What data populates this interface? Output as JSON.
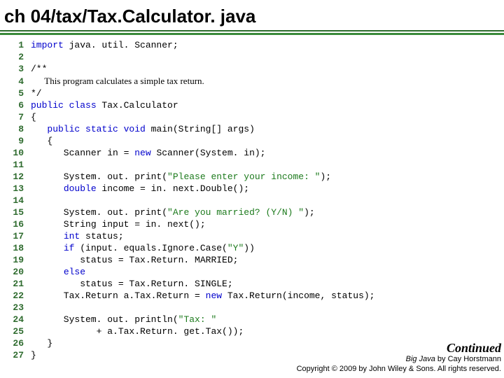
{
  "title": "ch 04/tax/Tax.Calculator. java",
  "code": {
    "lines": [
      {
        "n": "1",
        "seg": [
          {
            "t": "kw",
            "v": "import"
          },
          {
            "t": "p",
            "v": " java. util. Scanner;"
          }
        ]
      },
      {
        "n": "2",
        "seg": []
      },
      {
        "n": "3",
        "seg": [
          {
            "t": "p",
            "v": "/**"
          }
        ]
      },
      {
        "n": "4",
        "seg": [
          {
            "t": "com",
            "v": "      This program calculates a simple tax return."
          }
        ]
      },
      {
        "n": "5",
        "seg": [
          {
            "t": "p",
            "v": "*/"
          }
        ]
      },
      {
        "n": "6",
        "seg": [
          {
            "t": "kw",
            "v": "public class"
          },
          {
            "t": "p",
            "v": " Tax.Calculator"
          }
        ]
      },
      {
        "n": "7",
        "seg": [
          {
            "t": "p",
            "v": "{"
          }
        ]
      },
      {
        "n": "8",
        "seg": [
          {
            "t": "p",
            "v": "   "
          },
          {
            "t": "kw",
            "v": "public static void"
          },
          {
            "t": "p",
            "v": " main(String[] args)"
          }
        ]
      },
      {
        "n": "9",
        "seg": [
          {
            "t": "p",
            "v": "   {"
          }
        ]
      },
      {
        "n": "10",
        "seg": [
          {
            "t": "p",
            "v": "      Scanner in = "
          },
          {
            "t": "kw",
            "v": "new"
          },
          {
            "t": "p",
            "v": " Scanner(System. in);"
          }
        ]
      },
      {
        "n": "11",
        "seg": []
      },
      {
        "n": "12",
        "seg": [
          {
            "t": "p",
            "v": "      System. out. print("
          },
          {
            "t": "str",
            "v": "\"Please enter your income: \""
          },
          {
            "t": "p",
            "v": ");"
          }
        ]
      },
      {
        "n": "13",
        "seg": [
          {
            "t": "p",
            "v": "      "
          },
          {
            "t": "kw",
            "v": "double"
          },
          {
            "t": "p",
            "v": " income = in. next.Double();"
          }
        ]
      },
      {
        "n": "14",
        "seg": []
      },
      {
        "n": "15",
        "seg": [
          {
            "t": "p",
            "v": "      System. out. print("
          },
          {
            "t": "str",
            "v": "\"Are you married? (Y/N) \""
          },
          {
            "t": "p",
            "v": ");"
          }
        ]
      },
      {
        "n": "16",
        "seg": [
          {
            "t": "p",
            "v": "      String input = in. next();"
          }
        ]
      },
      {
        "n": "17",
        "seg": [
          {
            "t": "p",
            "v": "      "
          },
          {
            "t": "kw",
            "v": "int"
          },
          {
            "t": "p",
            "v": " status;"
          }
        ]
      },
      {
        "n": "18",
        "seg": [
          {
            "t": "p",
            "v": "      "
          },
          {
            "t": "kw",
            "v": "if"
          },
          {
            "t": "p",
            "v": " (input. equals.Ignore.Case("
          },
          {
            "t": "str",
            "v": "\"Y\""
          },
          {
            "t": "p",
            "v": "))"
          }
        ]
      },
      {
        "n": "19",
        "seg": [
          {
            "t": "p",
            "v": "         status = Tax.Return. MARRIED;"
          }
        ]
      },
      {
        "n": "20",
        "seg": [
          {
            "t": "p",
            "v": "      "
          },
          {
            "t": "kw",
            "v": "else"
          }
        ]
      },
      {
        "n": "21",
        "seg": [
          {
            "t": "p",
            "v": "         status = Tax.Return. SINGLE;"
          }
        ]
      },
      {
        "n": "22",
        "seg": [
          {
            "t": "p",
            "v": "      Tax.Return a.Tax.Return = "
          },
          {
            "t": "kw",
            "v": "new"
          },
          {
            "t": "p",
            "v": " Tax.Return(income, status);"
          }
        ]
      },
      {
        "n": "23",
        "seg": []
      },
      {
        "n": "24",
        "seg": [
          {
            "t": "p",
            "v": "      System. out. println("
          },
          {
            "t": "str",
            "v": "\"Tax: \""
          }
        ]
      },
      {
        "n": "25",
        "seg": [
          {
            "t": "p",
            "v": "            + a.Tax.Return. get.Tax());"
          }
        ]
      },
      {
        "n": "26",
        "seg": [
          {
            "t": "p",
            "v": "   }"
          }
        ]
      },
      {
        "n": "27",
        "seg": [
          {
            "t": "p",
            "v": "}"
          }
        ]
      }
    ]
  },
  "footer": {
    "continued": "Continued",
    "line1_a": "Big Java",
    "line1_b": " by Cay Horstmann",
    "line2": "Copyright © 2009 by John Wiley & Sons.  All rights reserved."
  }
}
